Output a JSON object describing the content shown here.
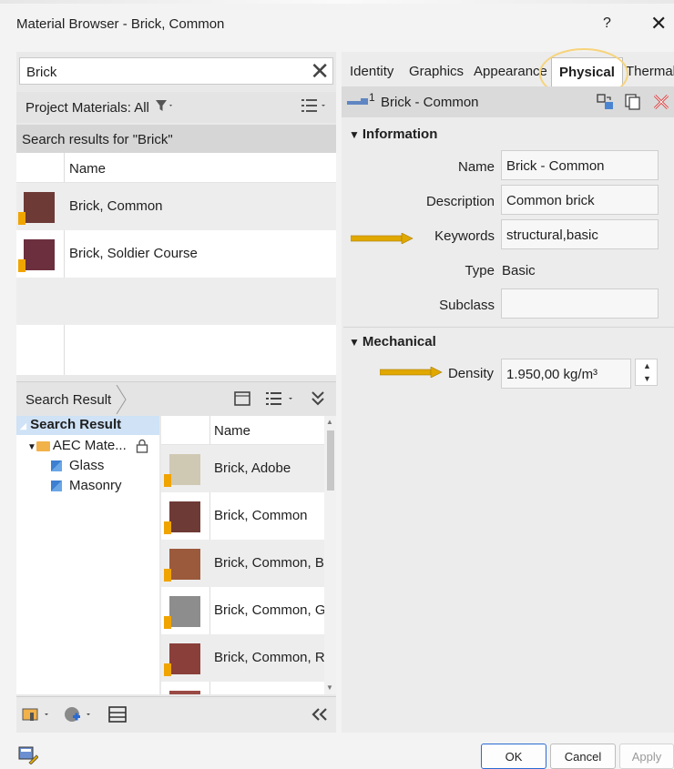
{
  "window": {
    "title": "Material Browser - Brick, Common",
    "help": "?",
    "close": "✕"
  },
  "search": {
    "value": "Brick",
    "clear": "✕"
  },
  "project_materials": {
    "label": "Project Materials: All",
    "filter_icon": "filter-icon",
    "view_icon": "list-view-icon"
  },
  "results_header": "Search results for \"Brick\"",
  "project_grid": {
    "column": "Name",
    "rows": [
      {
        "name": "Brick, Common",
        "color": "#6e3a36"
      },
      {
        "name": "Brick, Soldier Course",
        "color": "#6b2f3e"
      }
    ]
  },
  "library_bar": {
    "label": "Search Result"
  },
  "tree": {
    "root": "Search Result",
    "library": "AEC Mate...",
    "children": [
      "Glass",
      "Masonry"
    ]
  },
  "library_grid": {
    "column": "Name",
    "rows": [
      {
        "name": "Brick, Adobe",
        "color": "#cfc8b3"
      },
      {
        "name": "Brick, Common",
        "color": "#6e3a36"
      },
      {
        "name": "Brick, Common, Br",
        "color": "#9b5a3c"
      },
      {
        "name": "Brick, Common, Gr",
        "color": "#8d8d8d"
      },
      {
        "name": "Brick, Common, Re",
        "color": "#8a3f3a"
      }
    ]
  },
  "tabs": [
    "Identity",
    "Graphics",
    "Appearance",
    "Physical",
    "Thermal"
  ],
  "active_tab": "Physical",
  "asset": {
    "name": "Brick - Common",
    "count": "1"
  },
  "information": {
    "title": "Information",
    "name_label": "Name",
    "name_value": "Brick - Common",
    "description_label": "Description",
    "description_value": "Common brick",
    "keywords_label": "Keywords",
    "keywords_value": "structural,basic",
    "type_label": "Type",
    "type_value": "Basic",
    "subclass_label": "Subclass",
    "subclass_value": ""
  },
  "mechanical": {
    "title": "Mechanical",
    "density_label": "Density",
    "density_value": "1.950,00 kg/m³"
  },
  "footer": {
    "ok": "OK",
    "cancel": "Cancel",
    "apply": "Apply"
  },
  "colors": {
    "highlight_ring": "#f7d37a",
    "arrow": "#e0a800",
    "selection": "#cfe2f6",
    "primary_border": "#2a6bd3"
  }
}
